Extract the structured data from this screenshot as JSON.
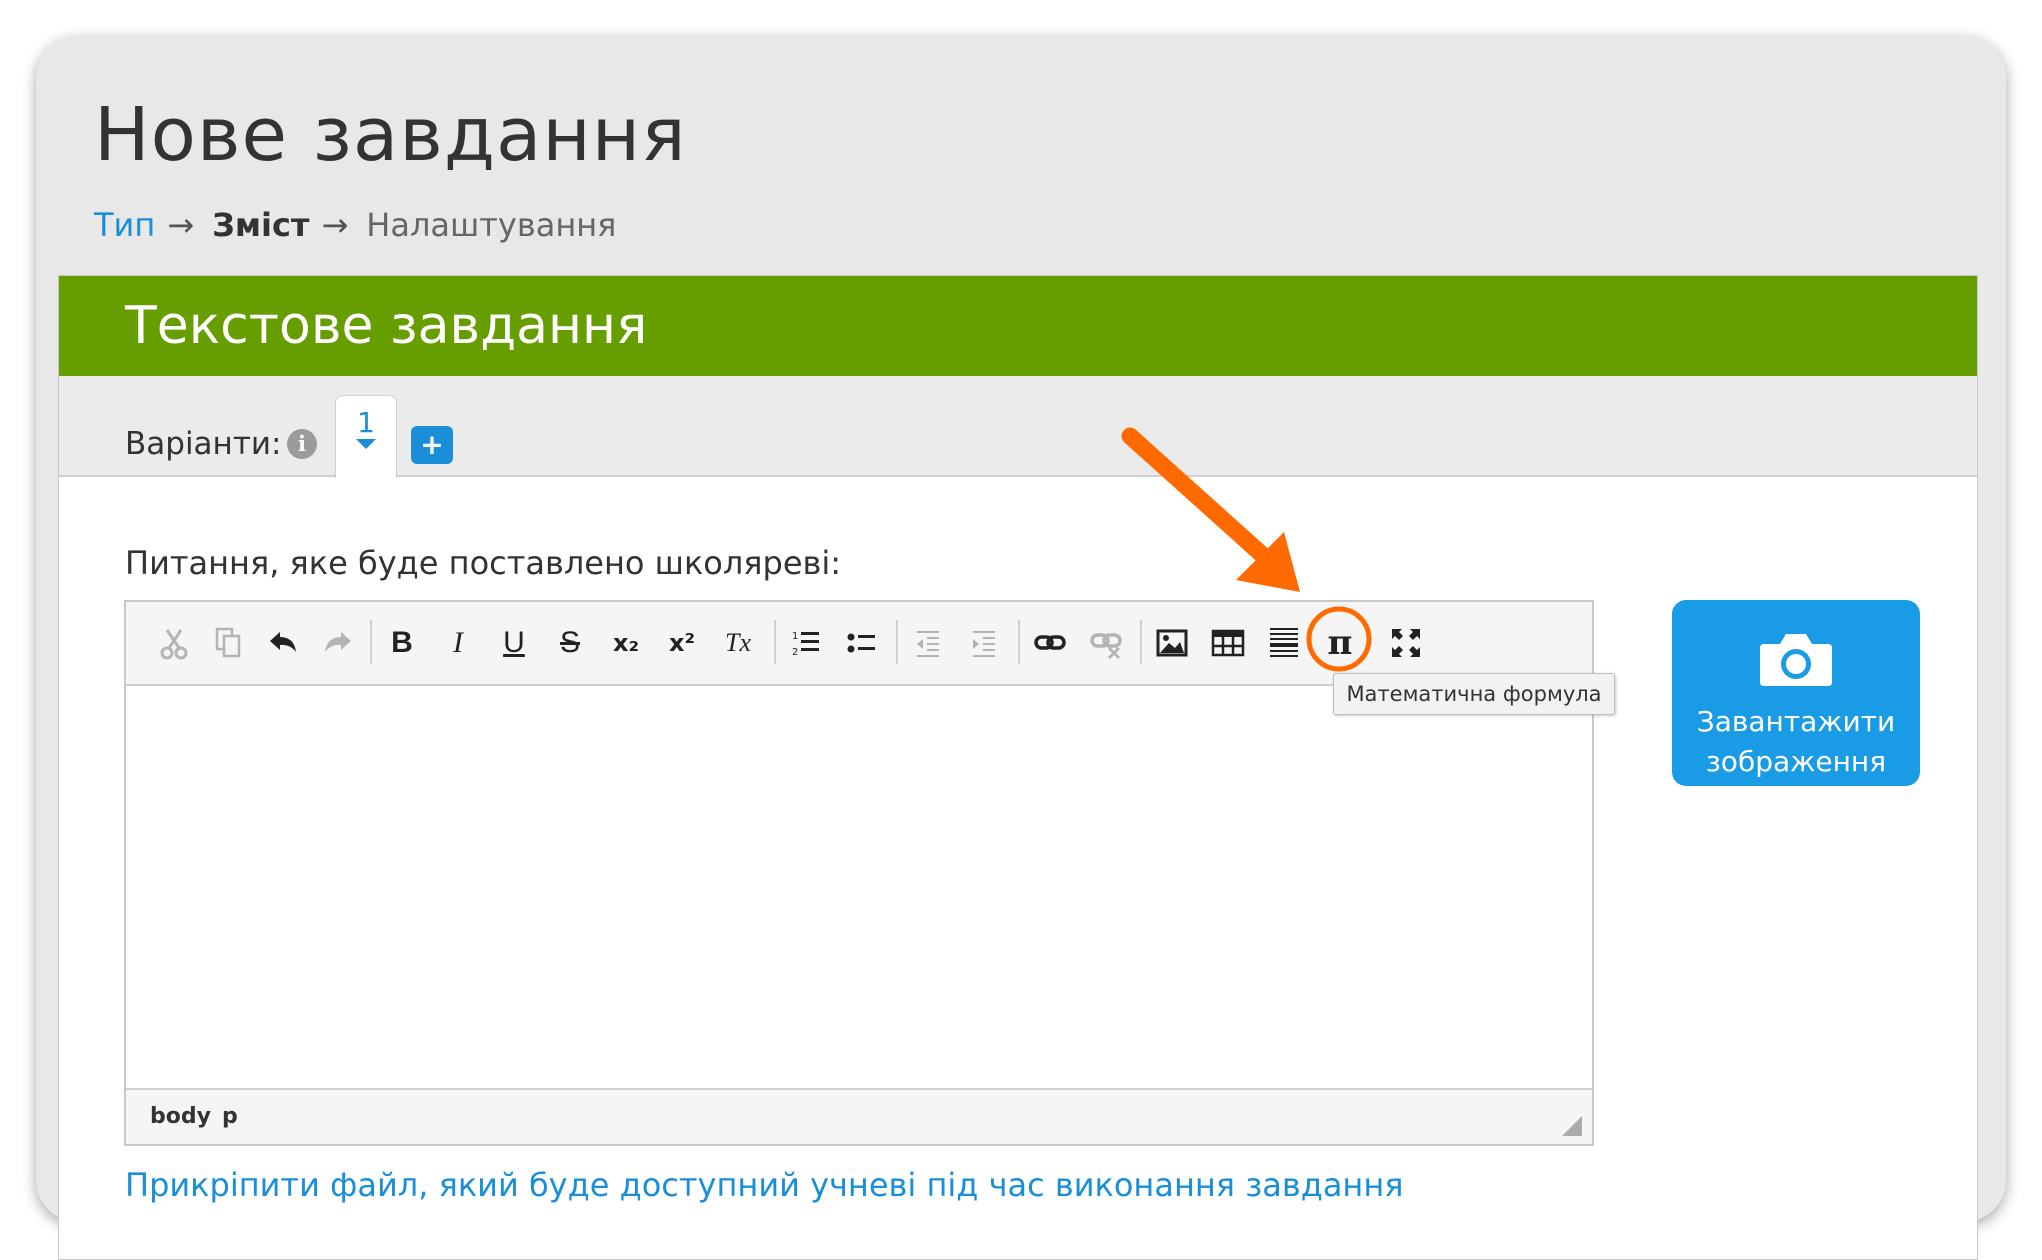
{
  "page": {
    "title": "Нове завдання"
  },
  "breadcrumb": {
    "step1": "Тип",
    "step2": "Зміст",
    "step3": "Налаштування",
    "arrow": "→"
  },
  "panel": {
    "title": "Текстове завдання"
  },
  "variants": {
    "label": "Варіанти:",
    "info_icon": "i",
    "active_tab": "1",
    "add_label": "+"
  },
  "question": {
    "label": "Питання, яке буде поставлено школяреві:"
  },
  "toolbar": {
    "bold": "B",
    "italic": "I",
    "underline": "U",
    "strike": "S",
    "subscript": "x₂",
    "superscript": "x²",
    "remove_format": "Tx",
    "math": "π"
  },
  "editor": {
    "path_body": "body",
    "path_p": "p"
  },
  "tooltip": {
    "text": "Математична формула"
  },
  "upload": {
    "line1": "Завантажити",
    "line2": "зображення"
  },
  "attach": {
    "text": "Прикріпити файл, який буде доступний учневі під час виконання завдання"
  },
  "colors": {
    "accent": "#1a8fd8",
    "header_green": "#669e00",
    "annotation_orange": "#ff6a00"
  }
}
